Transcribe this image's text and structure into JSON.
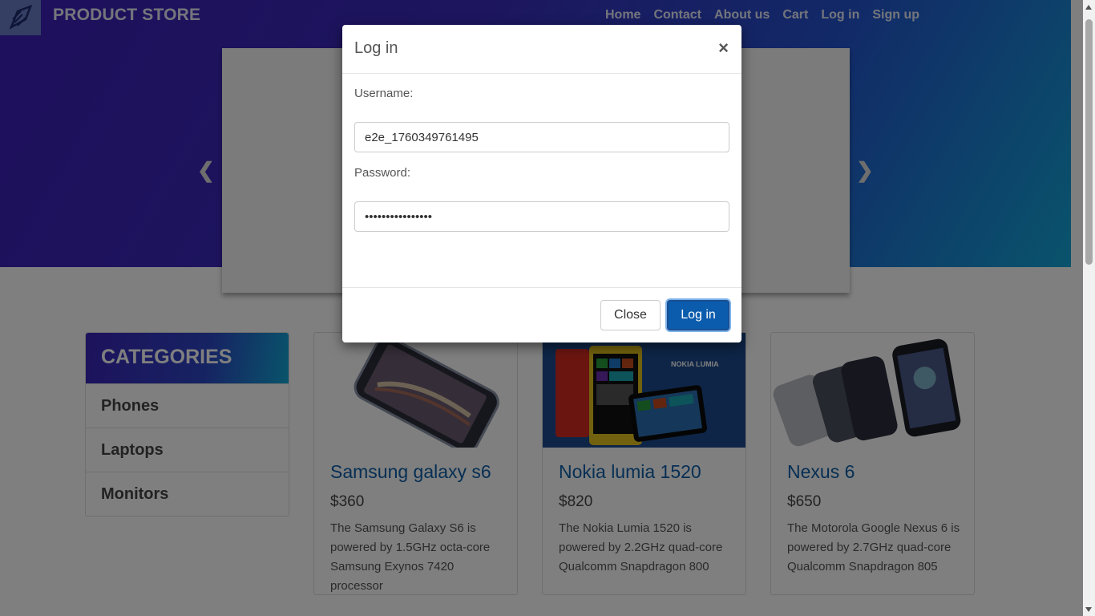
{
  "header": {
    "brand": "PRODUCT STORE",
    "nav": [
      "Home",
      "Contact",
      "About us",
      "Cart",
      "Log in",
      "Sign up"
    ]
  },
  "categories": {
    "title": "CATEGORIES",
    "items": [
      "Phones",
      "Laptops",
      "Monitors"
    ]
  },
  "products": [
    {
      "title": "Samsung galaxy s6",
      "price": "$360",
      "description": "The Samsung Galaxy S6 is powered by 1.5GHz octa-core Samsung Exynos 7420 processor"
    },
    {
      "title": "Nokia lumia 1520",
      "price": "$820",
      "description": "The Nokia Lumia 1520 is powered by 2.2GHz quad-core Qualcomm Snapdragon 800",
      "image_caption": "NOKIA LUMIA"
    },
    {
      "title": "Nexus 6",
      "price": "$650",
      "description": "The Motorola Google Nexus 6 is powered by 2.7GHz quad-core Qualcomm Snapdragon 805"
    }
  ],
  "modal": {
    "title": "Log in",
    "username_label": "Username:",
    "username_value": "e2e_1760349761495",
    "password_label": "Password:",
    "password_value": "••••••••••••••••",
    "close_label": "Close",
    "login_label": "Log in"
  },
  "colors": {
    "accent": "#0b5cad",
    "link": "#0d5ea8"
  }
}
